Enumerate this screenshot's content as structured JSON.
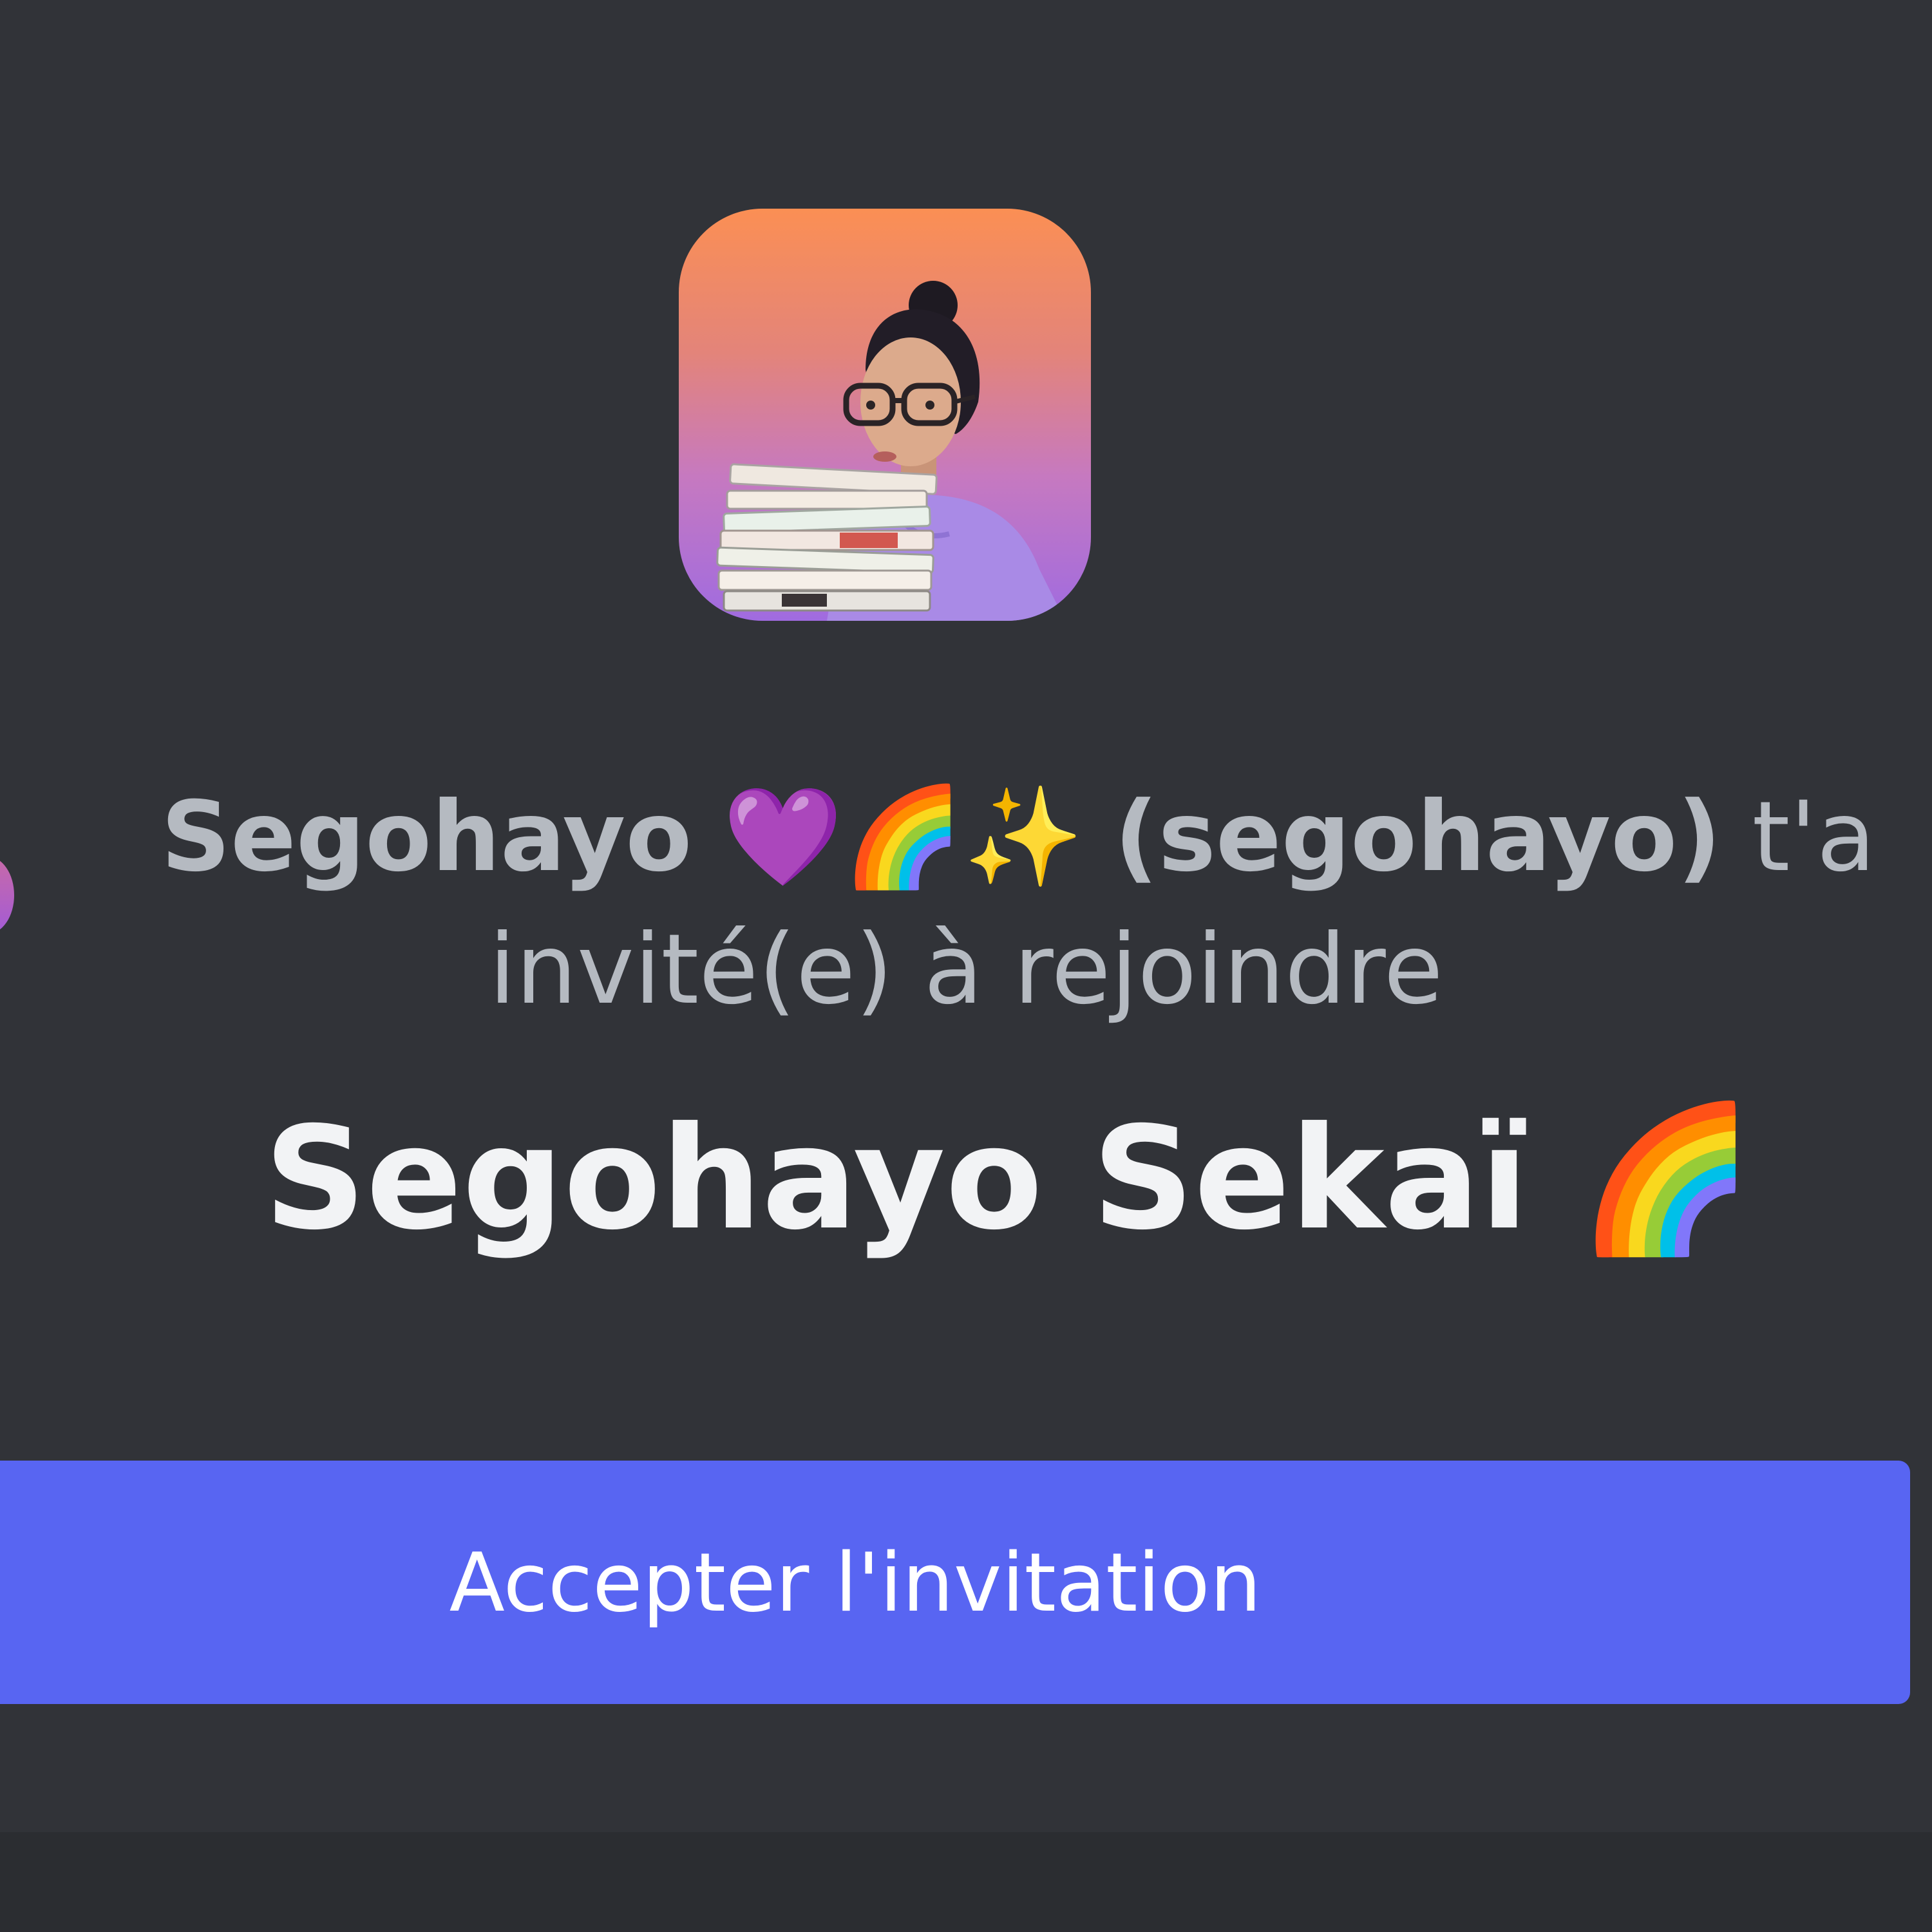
{
  "invite": {
    "inviter_display_name": "Segohayo",
    "inviter_emojis": "💜🌈✨",
    "inviter_username": "(segohayo)",
    "invite_text_suffix": "t'a",
    "invite_text_line2": "invité(e) à rejoindre"
  },
  "server": {
    "name": "Segohayo Sekaï",
    "name_emoji": "🌈"
  },
  "actions": {
    "accept_label": "Accepter l'invitation"
  },
  "colors": {
    "background": "#313338",
    "button": "#5865f2",
    "title_text": "#f2f3f5",
    "muted_text": "#b5bac1"
  }
}
